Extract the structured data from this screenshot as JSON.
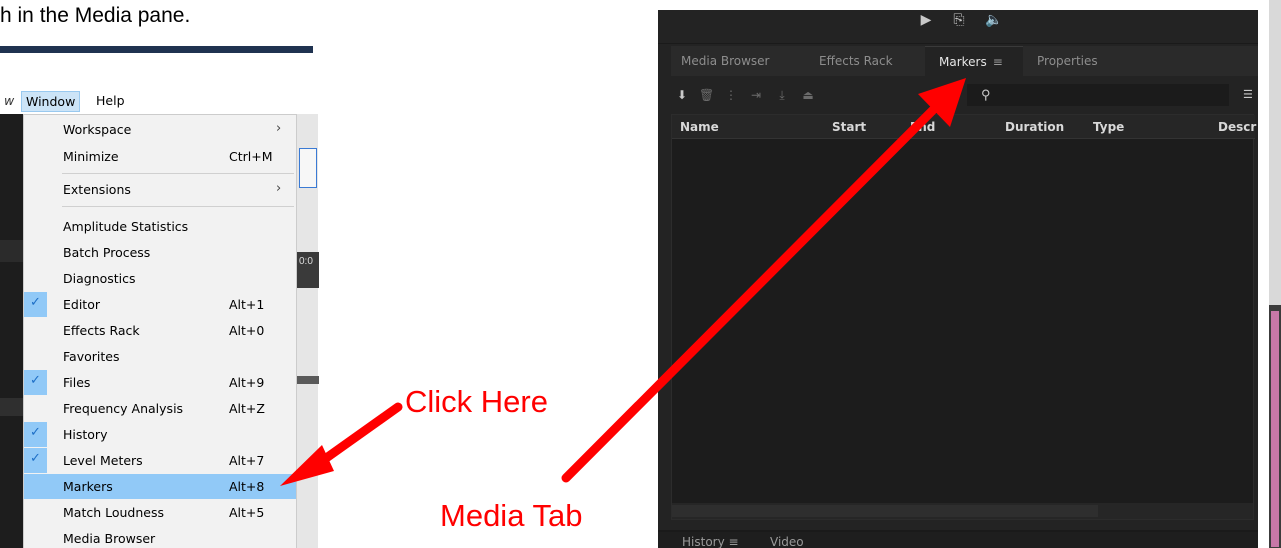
{
  "caption": {
    "text": "h in the Media pane."
  },
  "menubar": {
    "fragment": "w",
    "window": "Window",
    "help": "Help"
  },
  "window_menu": {
    "items": [
      {
        "label": "Workspace",
        "shortcut": "",
        "arrow": "›",
        "checked": false
      },
      {
        "label": "Minimize",
        "shortcut": "Ctrl+M",
        "arrow": "",
        "checked": false
      },
      {
        "label": "Extensions",
        "shortcut": "",
        "arrow": "›",
        "checked": false
      },
      {
        "label": "Amplitude Statistics",
        "shortcut": "",
        "arrow": "",
        "checked": false
      },
      {
        "label": "Batch Process",
        "shortcut": "",
        "arrow": "",
        "checked": false
      },
      {
        "label": "Diagnostics",
        "shortcut": "",
        "arrow": "",
        "checked": false
      },
      {
        "label": "Editor",
        "shortcut": "Alt+1",
        "arrow": "",
        "checked": true
      },
      {
        "label": "Effects Rack",
        "shortcut": "Alt+0",
        "arrow": "",
        "checked": false
      },
      {
        "label": "Favorites",
        "shortcut": "",
        "arrow": "",
        "checked": false
      },
      {
        "label": "Files",
        "shortcut": "Alt+9",
        "arrow": "",
        "checked": true
      },
      {
        "label": "Frequency Analysis",
        "shortcut": "Alt+Z",
        "arrow": "",
        "checked": false
      },
      {
        "label": "History",
        "shortcut": "",
        "arrow": "",
        "checked": true
      },
      {
        "label": "Level Meters",
        "shortcut": "Alt+7",
        "arrow": "",
        "checked": true
      },
      {
        "label": "Markers",
        "shortcut": "Alt+8",
        "arrow": "",
        "checked": false,
        "highlighted": true
      },
      {
        "label": "Match Loudness",
        "shortcut": "Alt+5",
        "arrow": "",
        "checked": false
      },
      {
        "label": "Media Browser",
        "shortcut": "",
        "arrow": "",
        "checked": false
      }
    ]
  },
  "annotations": {
    "click_here": "Click Here",
    "media_tab": "Media Tab"
  },
  "panel": {
    "tabs": [
      {
        "label": "Media Browser"
      },
      {
        "label": "Effects Rack"
      },
      {
        "label": "Markers",
        "active": true,
        "menu_glyph": "≡"
      },
      {
        "label": "Properties"
      }
    ],
    "columns": [
      "Name",
      "Start",
      "End",
      "Duration",
      "Type",
      "Descr"
    ],
    "bottom_tabs": [
      {
        "label": "History",
        "menu_glyph": "≡"
      },
      {
        "label": "Video"
      }
    ],
    "icons": {
      "transport": [
        "play-icon",
        "loop-icon",
        "speaker-icon"
      ],
      "toolbar": [
        "marker-icon",
        "delete-icon",
        "merge-markers-icon",
        "insert-to-playlist-icon",
        "export-markers-icon",
        "batch-process-icon",
        "search-icon",
        "filter-icon"
      ]
    }
  },
  "colors": {
    "annotation": "#ff0000",
    "menu_highlight": "#91c9f7",
    "panel_bg": "#232323"
  }
}
